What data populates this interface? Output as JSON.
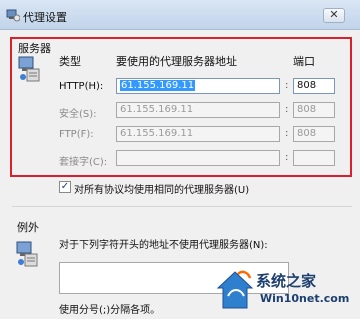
{
  "window": {
    "title": "代理设置",
    "close_label": "✕"
  },
  "servers": {
    "title": "服务器",
    "headers": {
      "type": "类型",
      "address": "要使用的代理服务器地址",
      "port": "端口"
    },
    "rows": [
      {
        "label": "HTTP(H):",
        "address": "61.155.169.11",
        "port": "808"
      },
      {
        "label": "安全(S):",
        "address": "61.155.169.11",
        "port": "808"
      },
      {
        "label": "FTP(F):",
        "address": "61.155.169.11",
        "port": "808"
      },
      {
        "label": "套接字(C):",
        "address": "",
        "port": ""
      }
    ],
    "colon": ":"
  },
  "same_proxy": {
    "checked_mark": "✓",
    "label": "对所有协议均使用相同的代理服务器(U)"
  },
  "exceptions": {
    "title": "例外",
    "description": "对于下列字符开头的地址不使用代理服务器(N):",
    "hint": "使用分号(;)分隔各项。"
  },
  "watermark": {
    "title": "系统之家",
    "url": "Win10net.com"
  }
}
